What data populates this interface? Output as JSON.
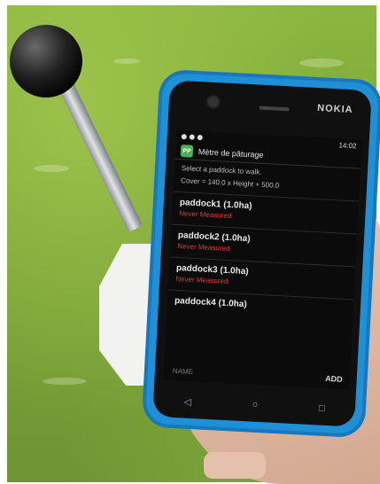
{
  "phone": {
    "brand": "NOKIA"
  },
  "status_bar": {
    "time": "14:02"
  },
  "app_bar": {
    "badge": "PP",
    "title": "Mètre de pâturage"
  },
  "hints": {
    "select": "Select a paddock to walk.",
    "formula": "Cover = 140.0 x Height + 500.0"
  },
  "paddocks": [
    {
      "title": "paddock1 (1.0ha)",
      "status": "Never Measured"
    },
    {
      "title": "paddock2 (1.0ha)",
      "status": "Never Measured"
    },
    {
      "title": "paddock3 (1.0ha)",
      "status": "Never Measured"
    },
    {
      "title": "paddock4 (1.0ha)",
      "status": ""
    }
  ],
  "footer": {
    "name_placeholder": "NAME",
    "add_label": "ADD"
  },
  "nav_icons": [
    "back-icon",
    "home-icon",
    "recents-icon"
  ],
  "colors": {
    "phone_case": "#1f8fd6",
    "never_measured": "#e03a2f",
    "badge": "#4caf50"
  }
}
